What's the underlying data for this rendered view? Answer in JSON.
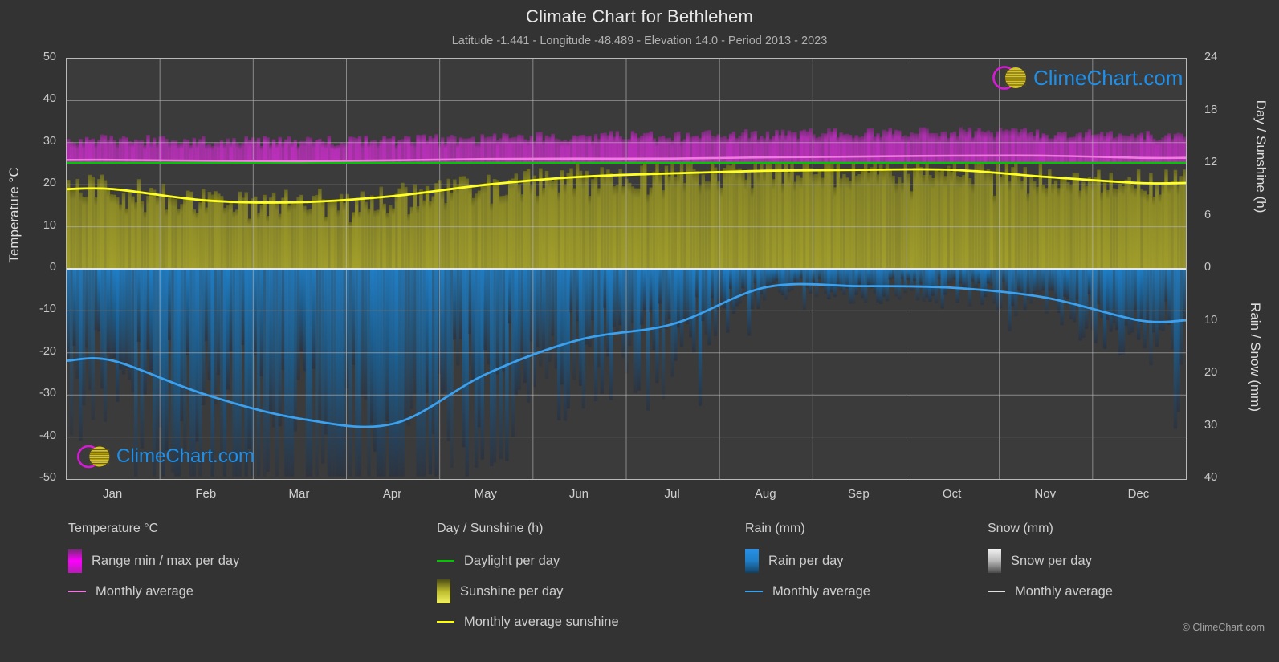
{
  "header": {
    "title": "Climate Chart for Bethlehem",
    "subtitle": "Latitude -1.441 - Longitude -48.489 - Elevation 14.0 - Period 2013 - 2023"
  },
  "axes": {
    "left_title": "Temperature °C",
    "right_top_title": "Day / Sunshine (h)",
    "right_bottom_title": "Rain / Snow (mm)",
    "left_ticks": [
      "50",
      "40",
      "30",
      "20",
      "10",
      "0",
      "-10",
      "-20",
      "-30",
      "-40",
      "-50"
    ],
    "right_ticks": [
      "24",
      "18",
      "12",
      "6",
      "0",
      "10",
      "20",
      "30",
      "40"
    ],
    "x_ticks": [
      "Jan",
      "Feb",
      "Mar",
      "Apr",
      "May",
      "Jun",
      "Jul",
      "Aug",
      "Sep",
      "Oct",
      "Nov",
      "Dec"
    ]
  },
  "legend": {
    "temperature": {
      "heading": "Temperature °C",
      "items": [
        {
          "label": "Range min / max per day",
          "key": "swatch",
          "color": "#ff00ff"
        },
        {
          "label": "Monthly average",
          "key": "line",
          "color": "#ee77dd"
        }
      ]
    },
    "day_sunshine": {
      "heading": "Day / Sunshine (h)",
      "items": [
        {
          "label": "Daylight per day",
          "key": "line",
          "color": "#00c800"
        },
        {
          "label": "Sunshine per day",
          "key": "swatch",
          "color": "#f0f040"
        },
        {
          "label": "Monthly average sunshine",
          "key": "line",
          "color": "#ffff00"
        }
      ]
    },
    "rain": {
      "heading": "Rain (mm)",
      "items": [
        {
          "label": "Rain per day",
          "key": "swatch",
          "color": "#1f8fe8"
        },
        {
          "label": "Monthly average",
          "key": "line",
          "color": "#3ba0ee"
        }
      ]
    },
    "snow": {
      "heading": "Snow (mm)",
      "items": [
        {
          "label": "Snow per day",
          "key": "swatch",
          "color": "#e8e8e8"
        },
        {
          "label": "Monthly average",
          "key": "line",
          "color": "#e0e0e0"
        }
      ]
    }
  },
  "branding": {
    "logo_text": "ClimeChart.com",
    "copyright": "© ClimeChart.com"
  },
  "chart_data": {
    "type": "area",
    "title": "Climate Chart for Bethlehem",
    "subtitle": "Latitude -1.441 - Longitude -48.489 - Elevation 14.0 - Period 2013 - 2023",
    "xlabel": "",
    "ylabel": "Temperature °C",
    "ylim": [
      -50,
      50
    ],
    "y2_top_label": "Day / Sunshine (h)",
    "y2_top_lim": [
      0,
      24
    ],
    "y2_bottom_label": "Rain / Snow (mm)",
    "y2_bottom_lim": [
      0,
      40
    ],
    "grid": true,
    "legend_position": "below",
    "categories": [
      "Jan",
      "Feb",
      "Mar",
      "Apr",
      "May",
      "Jun",
      "Jul",
      "Aug",
      "Sep",
      "Oct",
      "Nov",
      "Dec"
    ],
    "series": [
      {
        "name": "Temperature monthly average (°C)",
        "color": "#ee77dd",
        "values": [
          25.9,
          25.7,
          25.6,
          25.8,
          26.1,
          26.2,
          26.2,
          26.5,
          26.7,
          26.9,
          26.9,
          26.4
        ]
      },
      {
        "name": "Temperature range max per day (°C)",
        "color": "#ff00ff",
        "values": [
          30.5,
          30.2,
          30.1,
          30.4,
          31.0,
          31.3,
          31.4,
          31.8,
          32.0,
          32.2,
          32.1,
          31.4
        ]
      },
      {
        "name": "Temperature range min per day (°C)",
        "color": "#ff00ff",
        "values": [
          23.3,
          23.2,
          23.2,
          23.3,
          23.5,
          23.3,
          23.1,
          23.2,
          23.3,
          23.6,
          23.8,
          23.7
        ]
      },
      {
        "name": "Daylight per day (h)",
        "color": "#00c800",
        "values": [
          12.1,
          12.1,
          12.1,
          12.1,
          12.1,
          12.1,
          12.1,
          12.1,
          12.1,
          12.1,
          12.1,
          12.1
        ]
      },
      {
        "name": "Monthly average sunshine (h)",
        "color": "#ffff00",
        "values": [
          9.1,
          7.8,
          7.6,
          8.3,
          9.6,
          10.5,
          10.9,
          11.2,
          11.3,
          11.3,
          10.5,
          9.8
        ]
      },
      {
        "name": "Rain monthly average (mm)",
        "color": "#3ba0ee",
        "values": [
          17.5,
          24.0,
          28.5,
          29.5,
          20.0,
          13.5,
          10.5,
          3.5,
          3.3,
          3.6,
          5.5,
          9.8
        ]
      },
      {
        "name": "Snow monthly average (mm)",
        "color": "#e0e0e0",
        "values": [
          0,
          0,
          0,
          0,
          0,
          0,
          0,
          0,
          0,
          0,
          0,
          0
        ]
      }
    ]
  }
}
